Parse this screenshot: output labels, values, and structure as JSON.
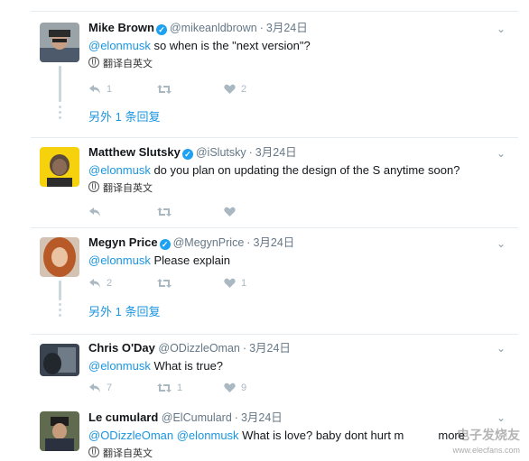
{
  "tweets": [
    {
      "name": "Mike Brown",
      "handle": "@mikeanldbrown",
      "time": "3月24日",
      "mention": "@elonmusk",
      "text": " so when is the \"next version\"?",
      "translate": "翻译自英文",
      "replies": "1",
      "retweets": "",
      "likes": "2",
      "more": "另外 1 条回复"
    },
    {
      "name": "Matthew Slutsky",
      "handle": "@iSlutsky",
      "time": "3月24日",
      "mention": "@elonmusk",
      "text": " do you plan on updating the design of the S anytime soon?",
      "translate": "翻译自英文",
      "replies": "",
      "retweets": "",
      "likes": ""
    },
    {
      "name": "Megyn Price",
      "handle": "@MegynPrice",
      "time": "3月24日",
      "mention": "@elonmusk",
      "text": " Please explain",
      "replies": "2",
      "retweets": "",
      "likes": "1",
      "more": "另外 1 条回复"
    },
    {
      "name": "Chris O'Day",
      "handle": "@ODizzleOman",
      "time": "3月24日",
      "mention": "@elonmusk",
      "text": " What is true?",
      "replies": "7",
      "retweets": "1",
      "likes": "9"
    },
    {
      "name": "Le cumulard",
      "handle": "@ElCumulard",
      "time": "3月24日",
      "mention": "@ODizzleOman @elonmusk",
      "text": " What is love? baby dont hurt m",
      "text_end": "more",
      "translate": "翻译自英文"
    }
  ],
  "watermark": {
    "title": "电子发烧友",
    "url": "www.elecfans.com"
  },
  "colors": {
    "accent": "#1b95e0",
    "verified": "#1da1f2",
    "muted": "#657786",
    "icon": "#aab8c2"
  },
  "icons": {
    "verified": "verified-badge-icon",
    "globe": "globe-icon",
    "reply": "reply-icon",
    "retweet": "retweet-icon",
    "like": "heart-icon",
    "caret": "chevron-down-icon"
  }
}
